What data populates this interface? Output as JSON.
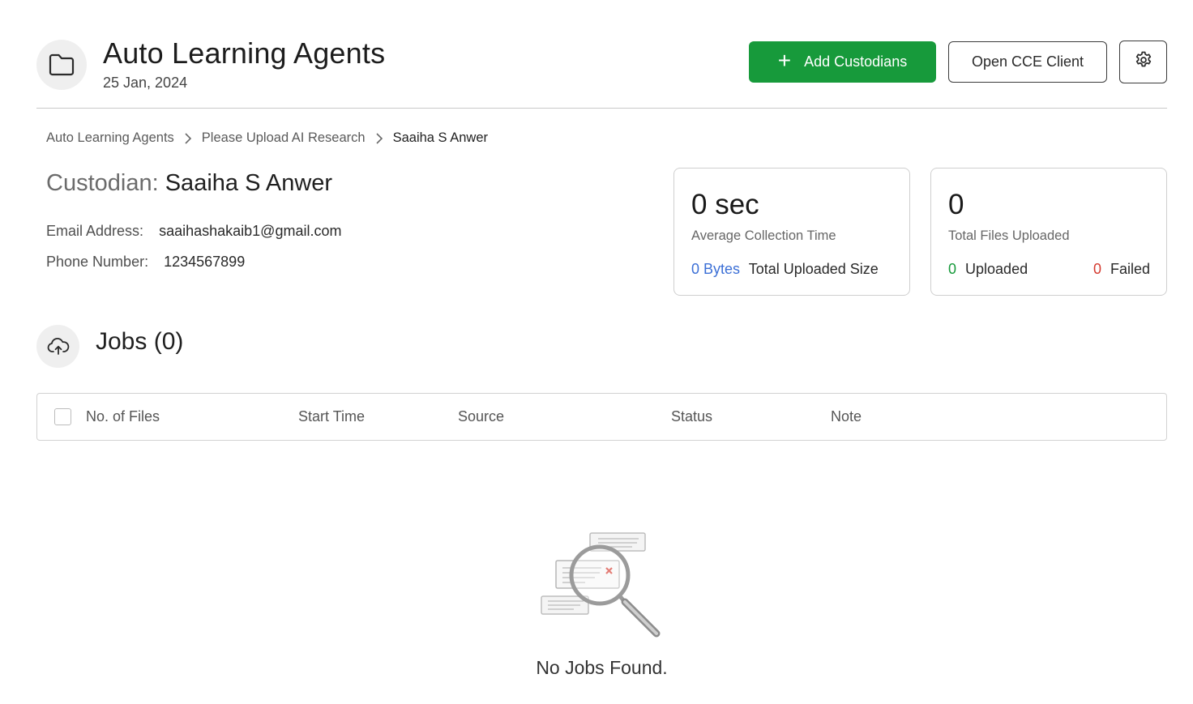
{
  "header": {
    "title": "Auto Learning Agents",
    "date": "25 Jan, 2024",
    "add_custodians_label": "Add Custodians",
    "open_cce_label": "Open CCE Client"
  },
  "breadcrumb": {
    "items": [
      "Auto Learning Agents",
      "Please Upload AI Research",
      "Saaiha S Anwer"
    ]
  },
  "custodian": {
    "heading_label": "Custodian:",
    "name": "Saaiha S Anwer",
    "email_label": "Email Address:",
    "email": "saaihashakaib1@gmail.com",
    "phone_label": "Phone Number:",
    "phone": "1234567899"
  },
  "stats": {
    "collection": {
      "value": "0 sec",
      "label": "Average Collection Time",
      "size_value": "0 Bytes",
      "size_label": "Total Uploaded Size"
    },
    "files": {
      "value": "0",
      "label": "Total Files Uploaded",
      "uploaded_value": "0",
      "uploaded_label": "Uploaded",
      "failed_value": "0",
      "failed_label": "Failed"
    }
  },
  "jobs": {
    "title": "Jobs (0)",
    "columns": [
      "No. of Files",
      "Start Time",
      "Source",
      "Status",
      "Note"
    ],
    "empty_text": "No Jobs Found."
  },
  "colors": {
    "primary_green": "#179a3b",
    "link_blue": "#3b6fd6",
    "error_red": "#d43a2f",
    "icon_bg": "#efefef"
  },
  "icons": {
    "project": "folder-icon",
    "add": "plus-icon",
    "settings": "gear-icon",
    "breadcrumb_separator": "chevron-right-icon",
    "jobs": "cloud-upload-icon",
    "empty": "search-no-results-illustration"
  }
}
